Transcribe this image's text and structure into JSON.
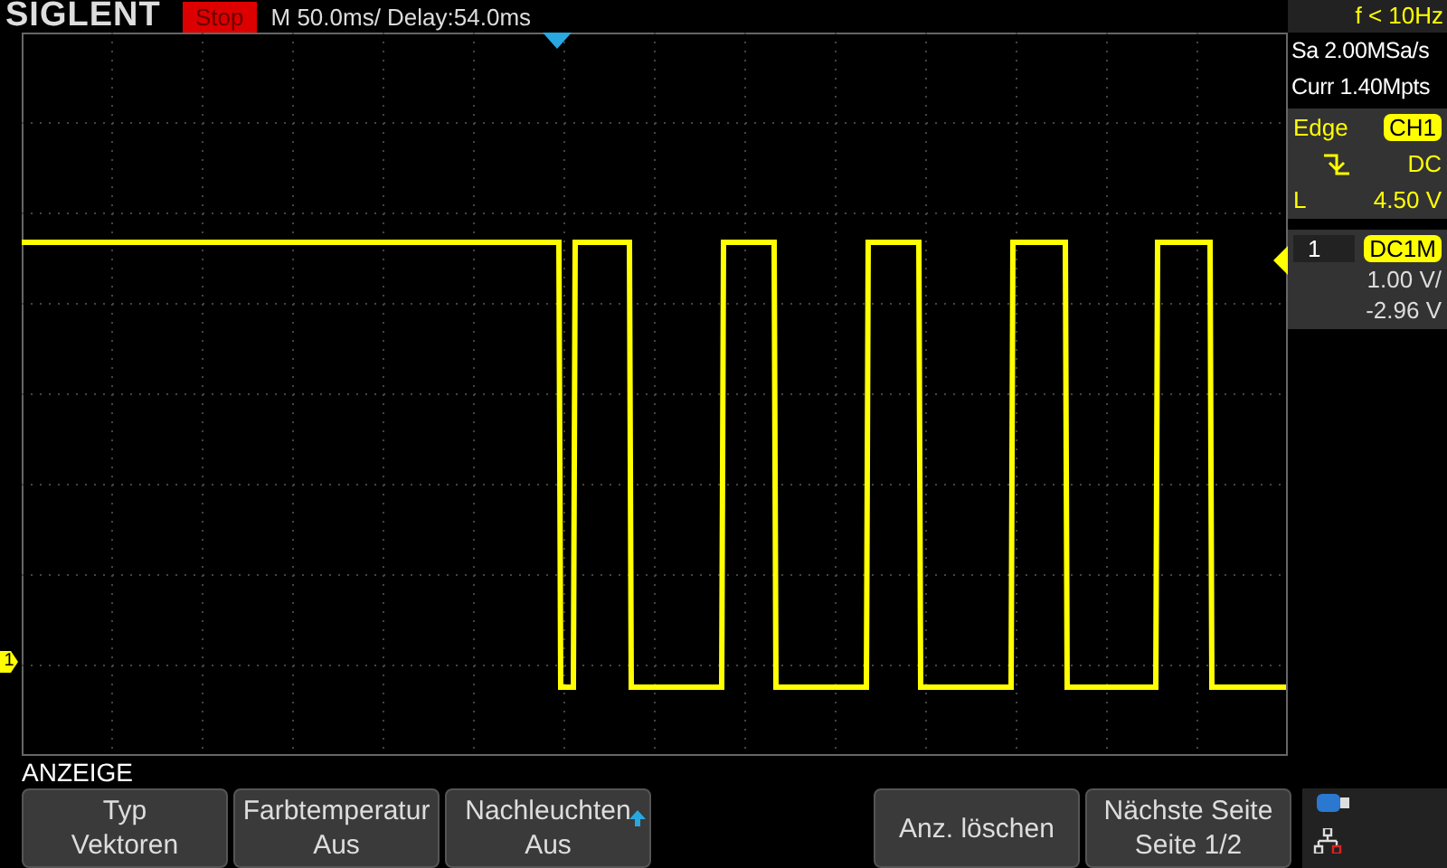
{
  "header": {
    "brand": "SIGLENT",
    "run_state": "Stop",
    "timebase": "M 50.0ms/ Delay:54.0ms",
    "trigger_frequency": "f < 10Hz"
  },
  "acquisition": {
    "sample_rate": "Sa 2.00MSa/s",
    "memory_depth": "Curr 1.40Mpts"
  },
  "trigger": {
    "type": "Edge",
    "source": "CH1",
    "coupling": "DC",
    "level_label": "L",
    "level": "4.50 V"
  },
  "channel": {
    "number": "1",
    "coupling": "DC1M",
    "scale": "1.00 V/",
    "offset": "-2.96 V"
  },
  "channel_marker": "1",
  "menu": {
    "title": "ANZEIGE",
    "buttons": [
      {
        "kind": "button",
        "lines": [
          "Typ",
          "Vektoren"
        ],
        "knob": false
      },
      {
        "kind": "button",
        "lines": [
          "Farbtemperatur",
          "Aus"
        ],
        "knob": false
      },
      {
        "kind": "button",
        "lines": [
          "Nachleuchten",
          "Aus"
        ],
        "knob": true
      },
      {
        "kind": "empty"
      },
      {
        "kind": "button",
        "lines": [
          "Anz. löschen"
        ],
        "knob": false
      },
      {
        "kind": "button",
        "lines": [
          "Nächste Seite",
          "Seite 1/2"
        ],
        "knob": false
      }
    ]
  }
}
